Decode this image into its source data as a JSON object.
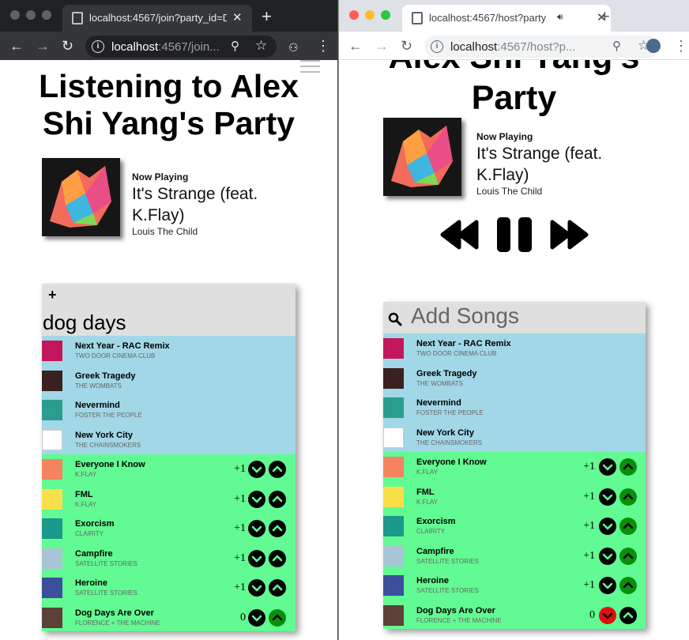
{
  "left_window": {
    "tab_title": "localhost:4567/join?party_id=D",
    "url_host": "localhost",
    "url_rest": ":4567/join...",
    "party_title": "Listening to Alex Shi Yang's Party",
    "now_playing": {
      "label": "Now Playing",
      "title": "It's Strange (feat. K.Flay)",
      "artist": "Louis The Child"
    },
    "search_value": "dog days"
  },
  "right_window": {
    "tab_title": "localhost:4567/host?party",
    "url_host": "localhost",
    "url_rest": ":4567/host?p...",
    "party_title_line1": "Alex Shi Yang's",
    "party_title_line2": "Party",
    "now_playing": {
      "label": "Now Playing",
      "title": "It's Strange (feat. K.Flay)",
      "artist": "Louis The Child"
    },
    "search_placeholder": "Add Songs"
  },
  "songs": [
    {
      "title": "Next Year - RAC Remix",
      "artist": "TWO DOOR CINEMA CLUB",
      "state": "played",
      "thumb_color": "#c2185b"
    },
    {
      "title": "Greek Tragedy",
      "artist": "THE WOMBATS",
      "state": "played",
      "thumb_color": "#3a2020"
    },
    {
      "title": "Nevermind",
      "artist": "FOSTER THE PEOPLE",
      "state": "played",
      "thumb_color": "#2a9d8f"
    },
    {
      "title": "New York City",
      "artist": "THE CHAINSMOKERS",
      "state": "played",
      "thumb_color": "#ffffff"
    },
    {
      "title": "Everyone I Know",
      "artist": "K.FLAY",
      "state": "queued",
      "score": "+1",
      "thumb_color": "#f4845f"
    },
    {
      "title": "FML",
      "artist": "K.FLAY",
      "state": "queued",
      "score": "+1",
      "thumb_color": "#f9e04b"
    },
    {
      "title": "Exorcism",
      "artist": "CLAIRITY",
      "state": "queued",
      "score": "+1",
      "thumb_color": "#1b998b"
    },
    {
      "title": "Campfire",
      "artist": "SATELLITE STORIES",
      "state": "queued",
      "score": "+1",
      "thumb_color": "#a8c5d6"
    },
    {
      "title": "Heroine",
      "artist": "SATELLITE STORIES",
      "state": "queued",
      "score": "+1",
      "thumb_color": "#3c4f9c"
    },
    {
      "title": "Dog Days Are Over",
      "artist": "FLORENCE + THE MACHINE",
      "state": "queued",
      "score": "0",
      "thumb_color": "#5d4037"
    }
  ],
  "left_votes": [
    {
      "down": "black",
      "up": "black"
    },
    {
      "down": "black",
      "up": "black"
    },
    {
      "down": "black",
      "up": "black"
    },
    {
      "down": "black",
      "up": "black"
    },
    {
      "down": "black",
      "up": "black"
    },
    {
      "down": "black",
      "up": "green"
    }
  ],
  "right_votes": [
    {
      "down": "black",
      "up": "green"
    },
    {
      "down": "black",
      "up": "green"
    },
    {
      "down": "black",
      "up": "green"
    },
    {
      "down": "black",
      "up": "green"
    },
    {
      "down": "black",
      "up": "green"
    },
    {
      "down": "red",
      "up": "black"
    }
  ],
  "colors": {
    "played_row": "#a1d7e6",
    "queued_row": "#62fa92",
    "vote_black": "#000000",
    "vote_green": "#0a8f0a",
    "vote_red": "#e01010"
  },
  "icons": [
    "back-icon",
    "forward-icon",
    "reload-icon",
    "zoom-icon",
    "star-icon",
    "incognito-icon",
    "menu-dots-icon",
    "rewind-icon",
    "pause-icon",
    "fast-forward-icon",
    "search-icon",
    "plus-icon",
    "vote-up-icon",
    "vote-down-icon"
  ]
}
